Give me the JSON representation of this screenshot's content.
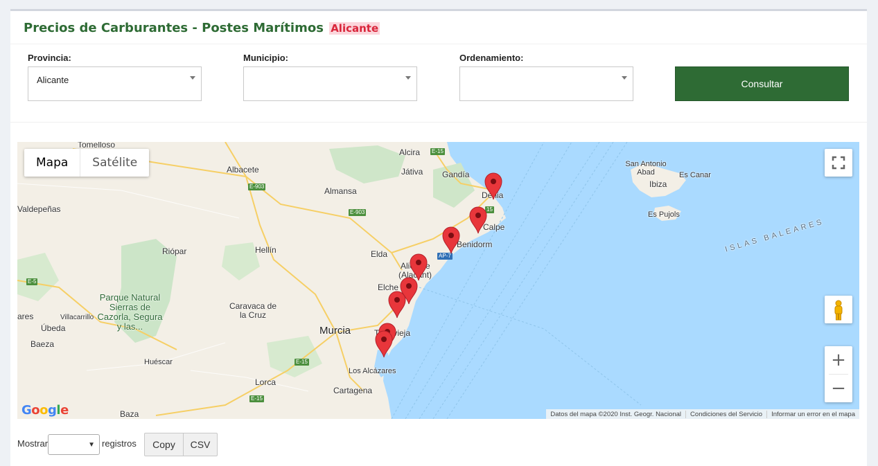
{
  "header": {
    "title": "Precios de Carburantes - Postes Marítimos",
    "badge": "Alicante"
  },
  "filters": {
    "provincia_label": "Provincia:",
    "provincia_value": "Alicante",
    "municipio_label": "Municipio:",
    "municipio_value": "",
    "orden_label": "Ordenamiento:",
    "orden_value": "",
    "submit_label": "Consultar"
  },
  "map": {
    "type_map": "Mapa",
    "type_satellite": "Satélite",
    "attribution": [
      "Datos del mapa ©2020 Inst. Geogr. Nacional",
      "Condiciones del Servicio",
      "Informar un error en el mapa"
    ],
    "logo": "Google",
    "places": {
      "tomelloso": "Tomelloso",
      "albacete": "Albacete",
      "alcira": "Alcira",
      "jativa": "Játiva",
      "gandia": "Gandía",
      "denia": "Denia",
      "almansa": "Almansa",
      "valdepenas": "Valdepeñas",
      "hellin": "Hellín",
      "riopar": "Riópar",
      "calpe": "Calpe",
      "benidorm": "Benidorm",
      "elda": "Elda",
      "alicante": "Alicante",
      "alacant": "(Alacant)",
      "elche": "Elche",
      "park": "Parque Natural Sierras de Cazorla, Segura y las...",
      "caravaca": "Caravaca de la Cruz",
      "ubeda": "Úbeda",
      "villacarrillo": "Villacarrillo",
      "ares": "ares",
      "murcia": "Murcia",
      "torrevieja": "Torrevieja",
      "baeza": "Baeza",
      "huescar": "Huéscar",
      "alcazares": "Los Alcázares",
      "lorca": "Lorca",
      "cartagena": "Cartagena",
      "baza": "Baza",
      "san_antonio": "San Antonio Abad",
      "ibiza": "Ibiza",
      "es_canar": "Es Canar",
      "es_pujols": "Es Pujols",
      "baleares": "ISLAS BALEARES"
    },
    "roads": {
      "e15a": "E-15",
      "e903a": "E-903",
      "e903b": "E-903",
      "e5": "E-5",
      "e15b": "E-15",
      "e15c": "E-15",
      "ap7": "AP-7",
      "e15d": "15"
    },
    "markers": 9
  },
  "table_controls": {
    "show_label": "Mostrar",
    "records_label": "registros",
    "copy_label": "Copy",
    "csv_label": "CSV"
  }
}
